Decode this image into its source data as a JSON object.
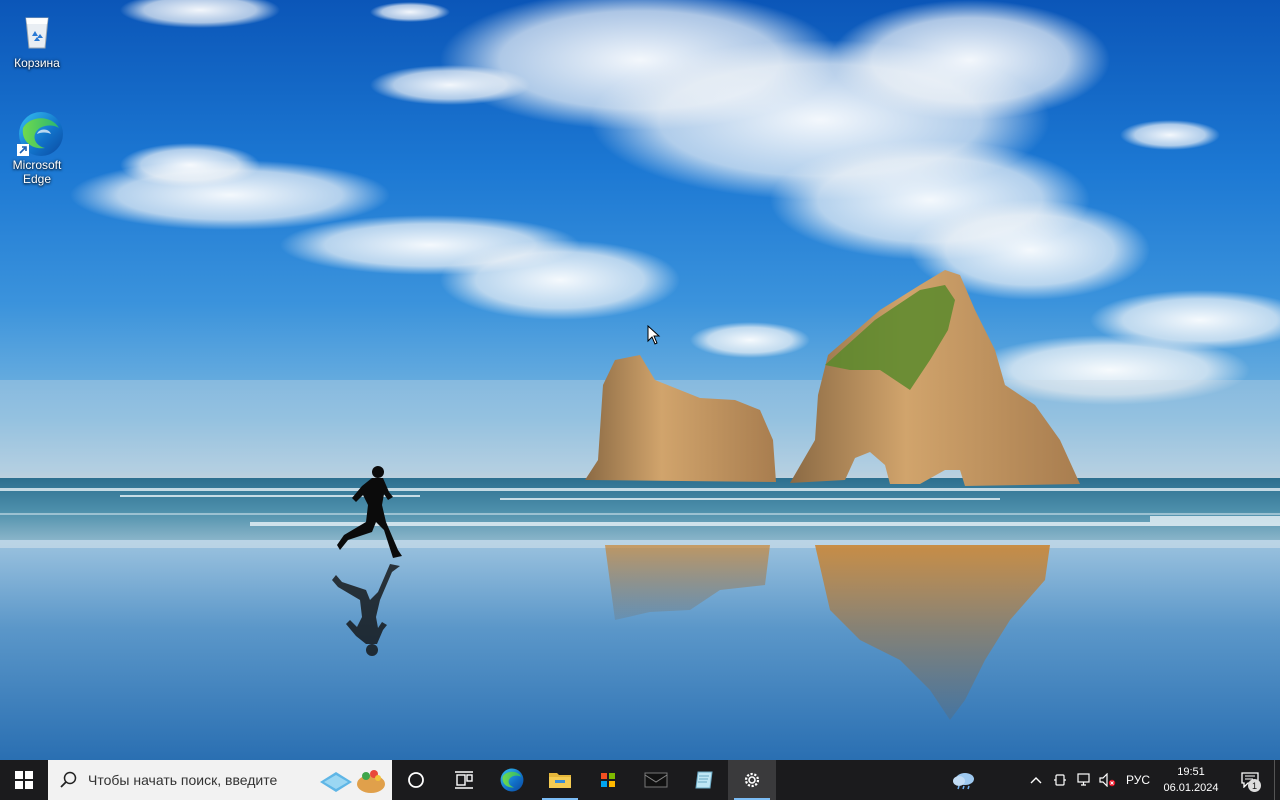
{
  "desktop": {
    "icons": [
      {
        "label": "Корзина",
        "icon": "recycle-bin-icon"
      },
      {
        "label": "Microsoft Edge",
        "icon": "edge-icon"
      }
    ]
  },
  "taskbar": {
    "search_placeholder": "Чтобы начать поиск, введите",
    "pinned": [
      {
        "icon": "cortana-icon"
      },
      {
        "icon": "task-view-icon"
      },
      {
        "icon": "edge-icon"
      },
      {
        "icon": "file-explorer-icon"
      },
      {
        "icon": "store-icon"
      },
      {
        "icon": "mail-icon"
      },
      {
        "icon": "notepad-icon"
      },
      {
        "icon": "settings-icon"
      }
    ],
    "tray": {
      "language": "РУС",
      "time": "19:51",
      "date": "06.01.2024",
      "notification_count": "1"
    }
  },
  "colors": {
    "taskbar": "#1b1b1d",
    "accent": "#7bbcf5"
  }
}
